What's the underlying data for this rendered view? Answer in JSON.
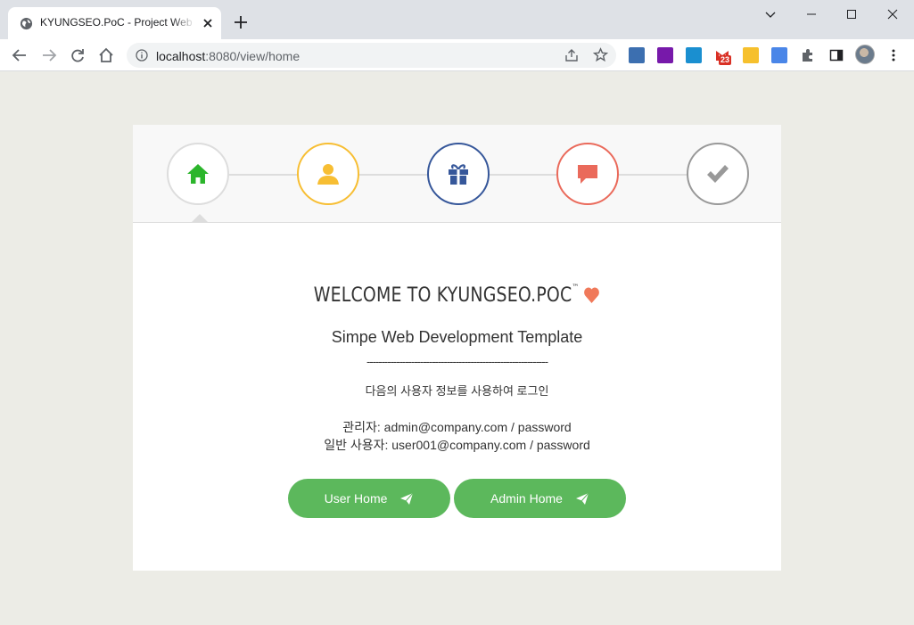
{
  "browser": {
    "tab_title": "KYUNGSEO.PoC - Project Web Site",
    "url_host": "localhost",
    "url_path": ":8080/view/home",
    "extension_badge": "23"
  },
  "steps": [
    {
      "icon": "home-icon",
      "color": "#2bb52b",
      "active": true
    },
    {
      "icon": "user-icon",
      "color": "#f7be33"
    },
    {
      "icon": "gift-icon",
      "color": "#36579a"
    },
    {
      "icon": "comment-icon",
      "color": "#ea6a5b"
    },
    {
      "icon": "check-icon",
      "color": "#999999"
    }
  ],
  "content": {
    "welcome": "WELCOME TO KYUNGSEO.POC",
    "trademark": "™",
    "subtitle": "Simpe Web Development Template",
    "divider": "-------------------------------------------------------------",
    "instruction": "다음의 사용자 정보를 사용하여 로그인",
    "admin_cred": "관리자: admin@company.com / password",
    "user_cred": "일반 사용자: user001@company.com / password"
  },
  "buttons": {
    "user_home": "User Home",
    "admin_home": "Admin Home"
  },
  "colors": {
    "accent_green": "#5cb85c",
    "heart": "#f0795a",
    "page_bg": "#ecece6"
  }
}
